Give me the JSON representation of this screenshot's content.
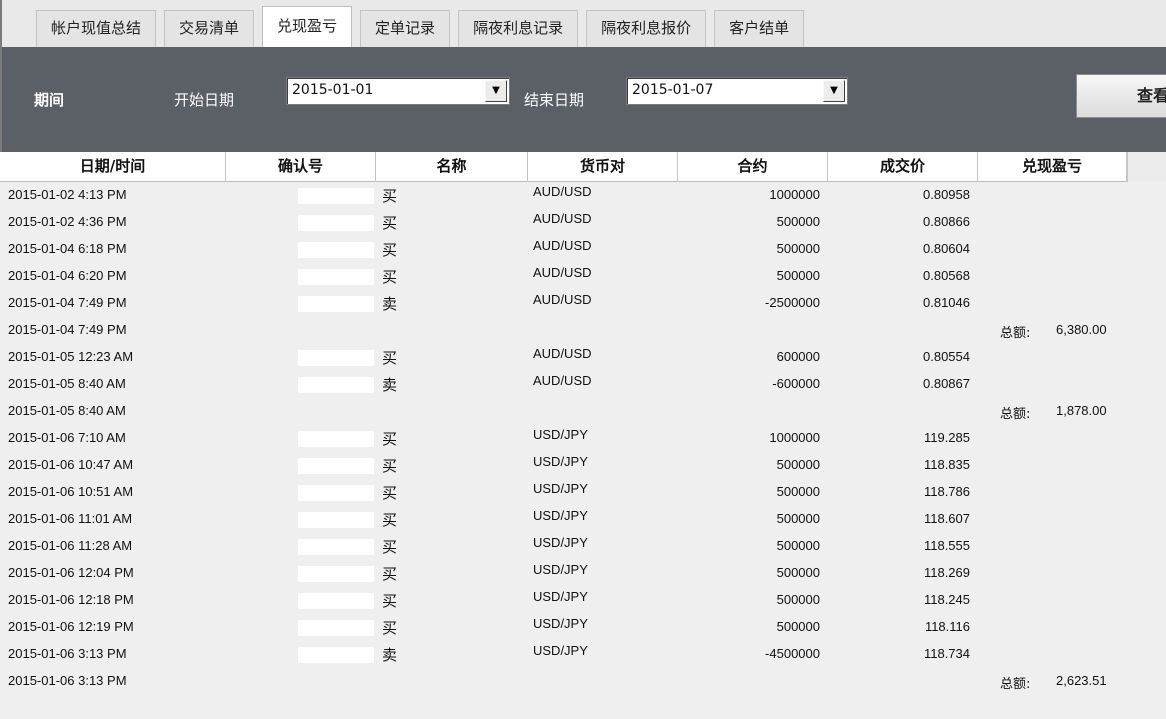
{
  "tabs": [
    {
      "label": "帐户现值总结"
    },
    {
      "label": "交易清单"
    },
    {
      "label": "兑现盈亏"
    },
    {
      "label": "定单记录"
    },
    {
      "label": "隔夜利息记录"
    },
    {
      "label": "隔夜利息报价"
    },
    {
      "label": "客户结单"
    }
  ],
  "active_tab": "兑现盈亏",
  "filter": {
    "period_label": "期间",
    "start_label": "开始日期",
    "start_value": "2015-01-01",
    "end_label": "结束日期",
    "end_value": "2015-01-07",
    "query_label": "查看"
  },
  "columns": [
    "日期/时间",
    "确认号",
    "名称",
    "货币对",
    "合约",
    "成交价",
    "兑现盈亏"
  ],
  "total_label": "总额:",
  "rows": [
    {
      "datetime": "2015-01-02 4:13 PM",
      "side": "买",
      "pair": "AUD/USD",
      "contract": "1000000",
      "price": "0.80958",
      "total": ""
    },
    {
      "datetime": "2015-01-02 4:36 PM",
      "side": "买",
      "pair": "AUD/USD",
      "contract": "500000",
      "price": "0.80866",
      "total": ""
    },
    {
      "datetime": "2015-01-04 6:18 PM",
      "side": "买",
      "pair": "AUD/USD",
      "contract": "500000",
      "price": "0.80604",
      "total": ""
    },
    {
      "datetime": "2015-01-04 6:20 PM",
      "side": "买",
      "pair": "AUD/USD",
      "contract": "500000",
      "price": "0.80568",
      "total": ""
    },
    {
      "datetime": "2015-01-04 7:49 PM",
      "side": "卖",
      "pair": "AUD/USD",
      "contract": "-2500000",
      "price": "0.81046",
      "total": ""
    },
    {
      "datetime": "2015-01-04 7:49 PM",
      "side": "",
      "pair": "",
      "contract": "",
      "price": "",
      "total": "6,380.00"
    },
    {
      "datetime": "2015-01-05 12:23 AM",
      "side": "买",
      "pair": "AUD/USD",
      "contract": "600000",
      "price": "0.80554",
      "total": ""
    },
    {
      "datetime": "2015-01-05 8:40 AM",
      "side": "卖",
      "pair": "AUD/USD",
      "contract": "-600000",
      "price": "0.80867",
      "total": ""
    },
    {
      "datetime": "2015-01-05 8:40 AM",
      "side": "",
      "pair": "",
      "contract": "",
      "price": "",
      "total": "1,878.00"
    },
    {
      "datetime": "2015-01-06 7:10 AM",
      "side": "买",
      "pair": "USD/JPY",
      "contract": "1000000",
      "price": "119.285",
      "total": ""
    },
    {
      "datetime": "2015-01-06 10:47 AM",
      "side": "买",
      "pair": "USD/JPY",
      "contract": "500000",
      "price": "118.835",
      "total": ""
    },
    {
      "datetime": "2015-01-06 10:51 AM",
      "side": "买",
      "pair": "USD/JPY",
      "contract": "500000",
      "price": "118.786",
      "total": ""
    },
    {
      "datetime": "2015-01-06 11:01 AM",
      "side": "买",
      "pair": "USD/JPY",
      "contract": "500000",
      "price": "118.607",
      "total": ""
    },
    {
      "datetime": "2015-01-06 11:28 AM",
      "side": "买",
      "pair": "USD/JPY",
      "contract": "500000",
      "price": "118.555",
      "total": ""
    },
    {
      "datetime": "2015-01-06 12:04 PM",
      "side": "买",
      "pair": "USD/JPY",
      "contract": "500000",
      "price": "118.269",
      "total": ""
    },
    {
      "datetime": "2015-01-06 12:18 PM",
      "side": "买",
      "pair": "USD/JPY",
      "contract": "500000",
      "price": "118.245",
      "total": ""
    },
    {
      "datetime": "2015-01-06 12:19 PM",
      "side": "买",
      "pair": "USD/JPY",
      "contract": "500000",
      "price": "118.116",
      "total": ""
    },
    {
      "datetime": "2015-01-06 3:13 PM",
      "side": "卖",
      "pair": "USD/JPY",
      "contract": "-4500000",
      "price": "118.734",
      "total": ""
    },
    {
      "datetime": "2015-01-06 3:13 PM",
      "side": "",
      "pair": "",
      "contract": "",
      "price": "",
      "total": "2,623.51"
    }
  ]
}
